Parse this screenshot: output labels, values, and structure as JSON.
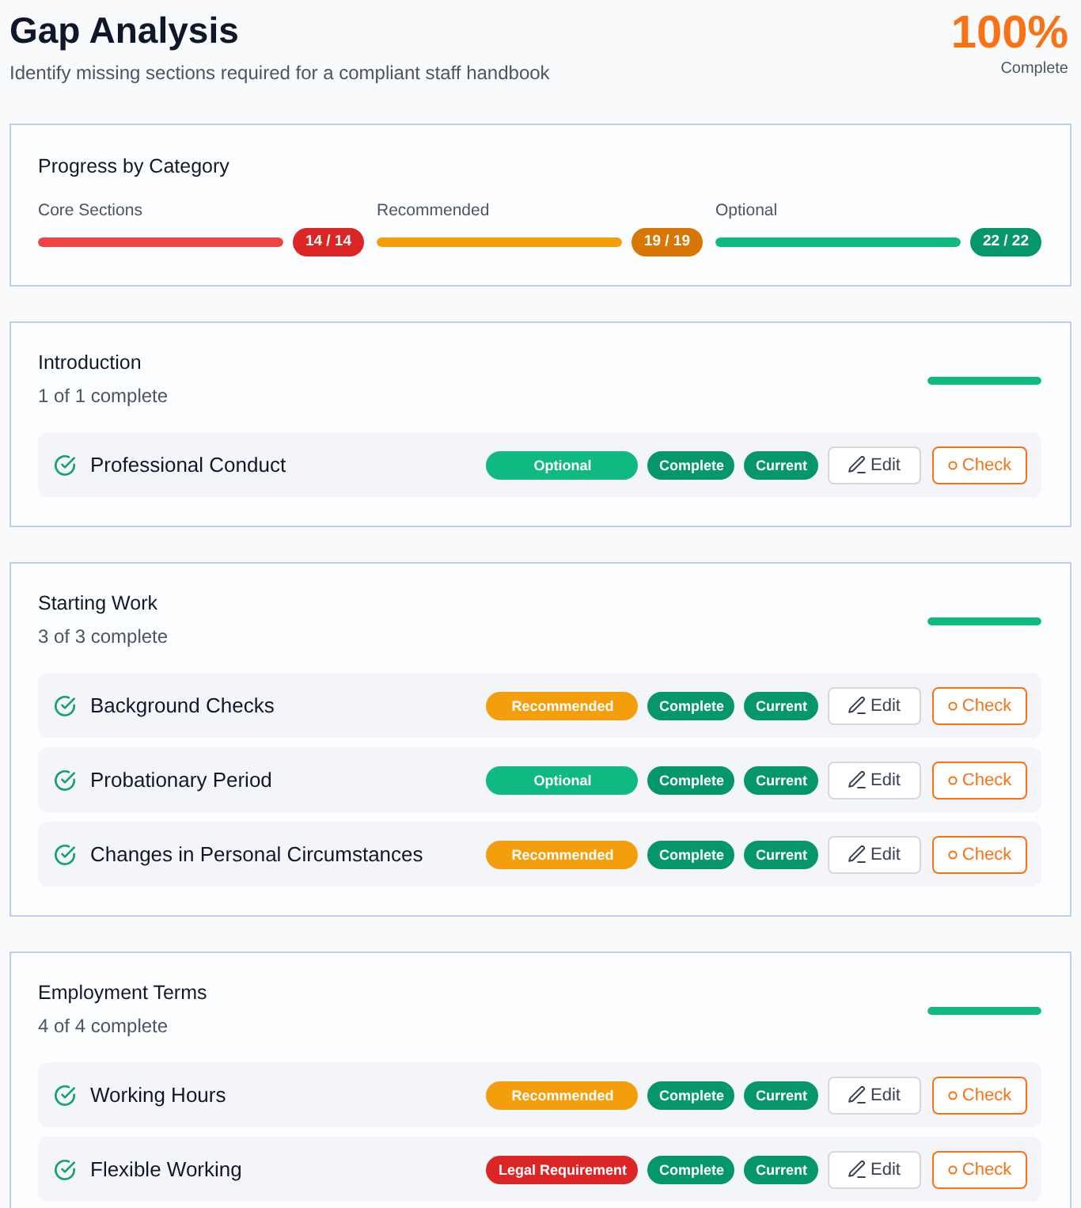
{
  "header": {
    "title": "Gap Analysis",
    "subtitle": "Identify missing sections required for a compliant staff handbook",
    "score": "100%",
    "score_label": "Complete"
  },
  "category_progress": {
    "title": "Progress by Category",
    "categories": [
      {
        "label": "Core Sections",
        "kind": "core",
        "level": 1,
        "count": "14 / 14"
      },
      {
        "label": "Recommended",
        "kind": "recommended",
        "level": 1,
        "count": "19 / 19"
      },
      {
        "label": "Optional",
        "kind": "optional",
        "level": 1,
        "count": "22 / 22"
      }
    ]
  },
  "sections": [
    {
      "title": "Introduction",
      "summary": "1 of 1 complete",
      "level": 1,
      "items": [
        {
          "name": "Professional Conduct",
          "done": true,
          "priority": {
            "label": "Optional",
            "kind": "optional"
          },
          "status": "Complete",
          "version": "Current",
          "edit": "Edit",
          "check": "Check"
        }
      ]
    },
    {
      "title": "Starting Work",
      "summary": "3 of 3 complete",
      "level": 1,
      "items": [
        {
          "name": "Background Checks",
          "done": true,
          "priority": {
            "label": "Recommended",
            "kind": "recommended"
          },
          "status": "Complete",
          "version": "Current",
          "edit": "Edit",
          "check": "Check"
        },
        {
          "name": "Probationary Period",
          "done": true,
          "priority": {
            "label": "Optional",
            "kind": "optional"
          },
          "status": "Complete",
          "version": "Current",
          "edit": "Edit",
          "check": "Check"
        },
        {
          "name": "Changes in Personal Circumstances",
          "done": true,
          "priority": {
            "label": "Recommended",
            "kind": "recommended"
          },
          "status": "Complete",
          "version": "Current",
          "edit": "Edit",
          "check": "Check"
        }
      ]
    },
    {
      "title": "Employment Terms",
      "summary": "4 of 4 complete",
      "level": 1,
      "items": [
        {
          "name": "Working Hours",
          "done": true,
          "priority": {
            "label": "Recommended",
            "kind": "recommended"
          },
          "status": "Complete",
          "version": "Current",
          "edit": "Edit",
          "check": "Check"
        },
        {
          "name": "Flexible Working",
          "done": true,
          "priority": {
            "label": "Legal Requirement",
            "kind": "legal"
          },
          "status": "Complete",
          "version": "Current",
          "edit": "Edit",
          "check": "Check"
        }
      ]
    }
  ]
}
